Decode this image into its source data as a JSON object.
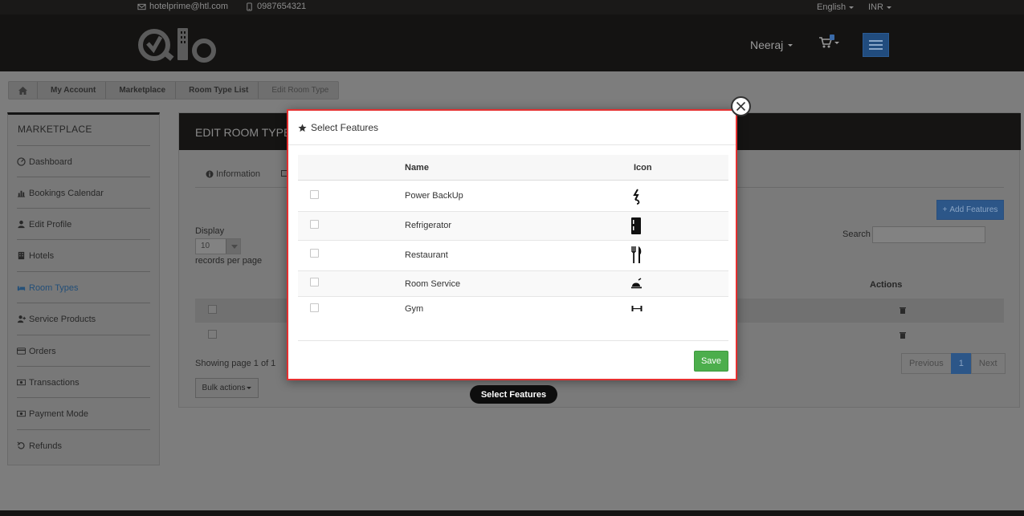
{
  "topbar": {
    "email": "hotelprime@htl.com",
    "phone": "0987654321",
    "language": "English",
    "currency": "INR"
  },
  "header": {
    "user_name": "Neeraj",
    "cart_count": "1"
  },
  "breadcrumb": {
    "items": [
      "My Account",
      "Marketplace",
      "Room Type List"
    ],
    "current": "Edit Room Type"
  },
  "sidebar": {
    "title": "MARKETPLACE",
    "items": [
      {
        "label": "Dashboard",
        "icon": "dashboard-icon"
      },
      {
        "label": "Bookings Calendar",
        "icon": "bar-chart-icon"
      },
      {
        "label": "Edit Profile",
        "icon": "user-icon"
      },
      {
        "label": "Hotels",
        "icon": "building-icon"
      },
      {
        "label": "Room Types",
        "icon": "bed-icon"
      },
      {
        "label": "Service Products",
        "icon": "user-plus-icon"
      },
      {
        "label": "Orders",
        "icon": "credit-card-icon"
      },
      {
        "label": "Transactions",
        "icon": "money-icon"
      },
      {
        "label": "Payment Mode",
        "icon": "money-icon"
      },
      {
        "label": "Refunds",
        "icon": "undo-icon"
      }
    ],
    "active_index": 4,
    "active_color": "#234f78"
  },
  "main": {
    "heading": "EDIT ROOM TYPE",
    "tab_information": "Information",
    "add_features_label": "Add Features",
    "display_label": "Display",
    "records_per_page_value": "10",
    "records_per_page_label": "records per page",
    "search_label": "Search",
    "actions_header": "Actions",
    "showing": "Showing page 1 of 1",
    "bulk_actions": "Bulk actions",
    "pagination": {
      "previous": "Previous",
      "current": "1",
      "next": "Next"
    }
  },
  "modal": {
    "title": "Select Features",
    "columns": {
      "name": "Name",
      "icon": "Icon"
    },
    "features": [
      {
        "name": "Power BackUp",
        "icon": "power-backup-icon"
      },
      {
        "name": "Refrigerator",
        "icon": "refrigerator-icon"
      },
      {
        "name": "Restaurant",
        "icon": "restaurant-icon"
      },
      {
        "name": "Room Service",
        "icon": "room-service-icon"
      },
      {
        "name": "Gym",
        "icon": "gym-icon"
      }
    ],
    "save_label": "Save",
    "border_color": "#e53030",
    "save_color": "#4cae4c"
  },
  "tooltip": "Select Features"
}
